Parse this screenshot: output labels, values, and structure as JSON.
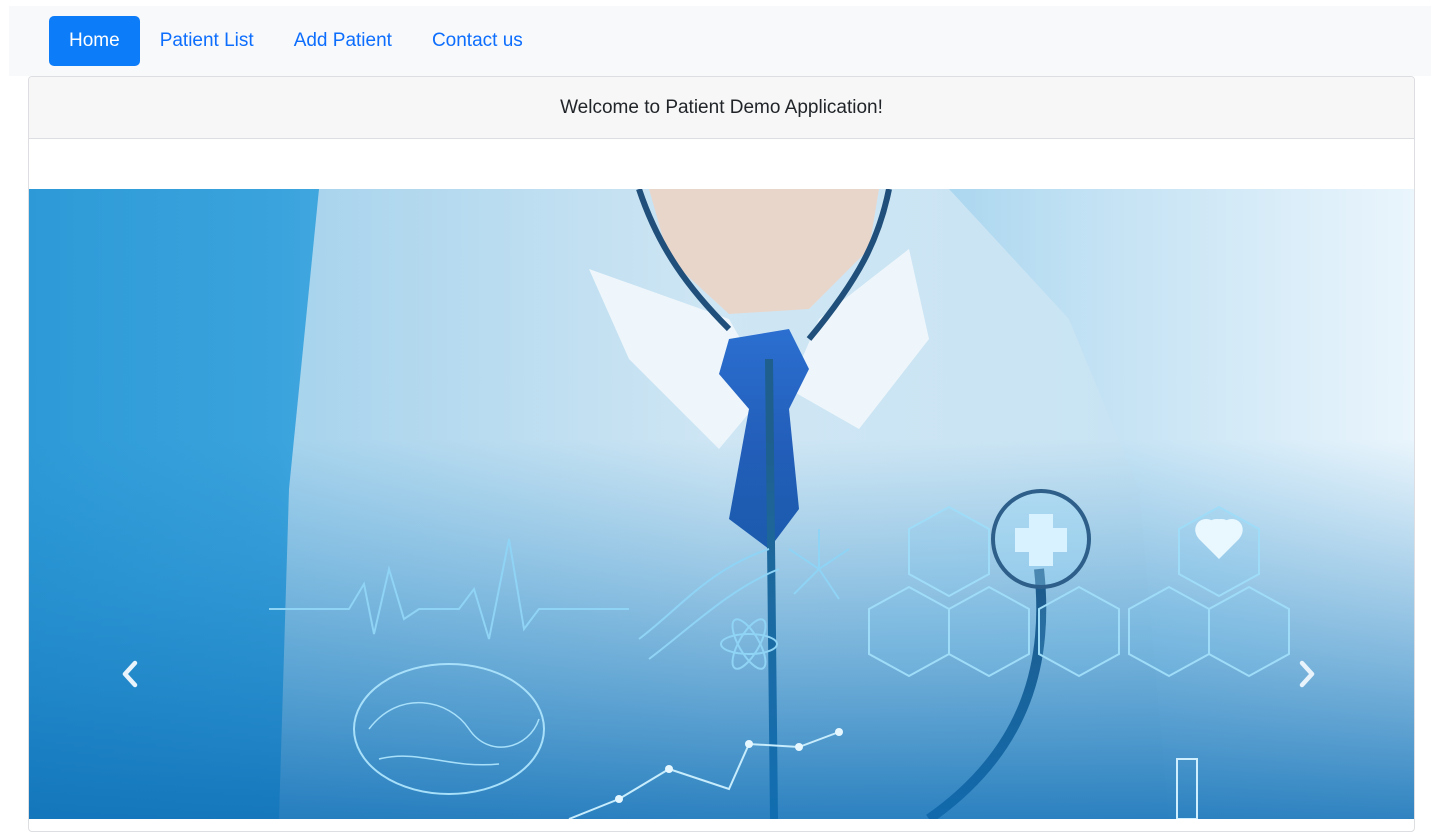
{
  "nav": {
    "items": [
      {
        "label": "Home",
        "active": true
      },
      {
        "label": "Patient List",
        "active": false
      },
      {
        "label": "Add Patient",
        "active": false
      },
      {
        "label": "Contact us",
        "active": false
      }
    ]
  },
  "card": {
    "header": "Welcome to Patient Demo Application!"
  },
  "carousel": {
    "prev_icon": "chevron-left-icon",
    "next_icon": "chevron-right-icon",
    "image": "doctor-with-stethoscope-medical-icons"
  },
  "colors": {
    "accent": "#0d7cf8",
    "link": "#0d6efd",
    "navbar_bg": "#f8f9fa",
    "card_header_bg": "#f7f7f7"
  }
}
